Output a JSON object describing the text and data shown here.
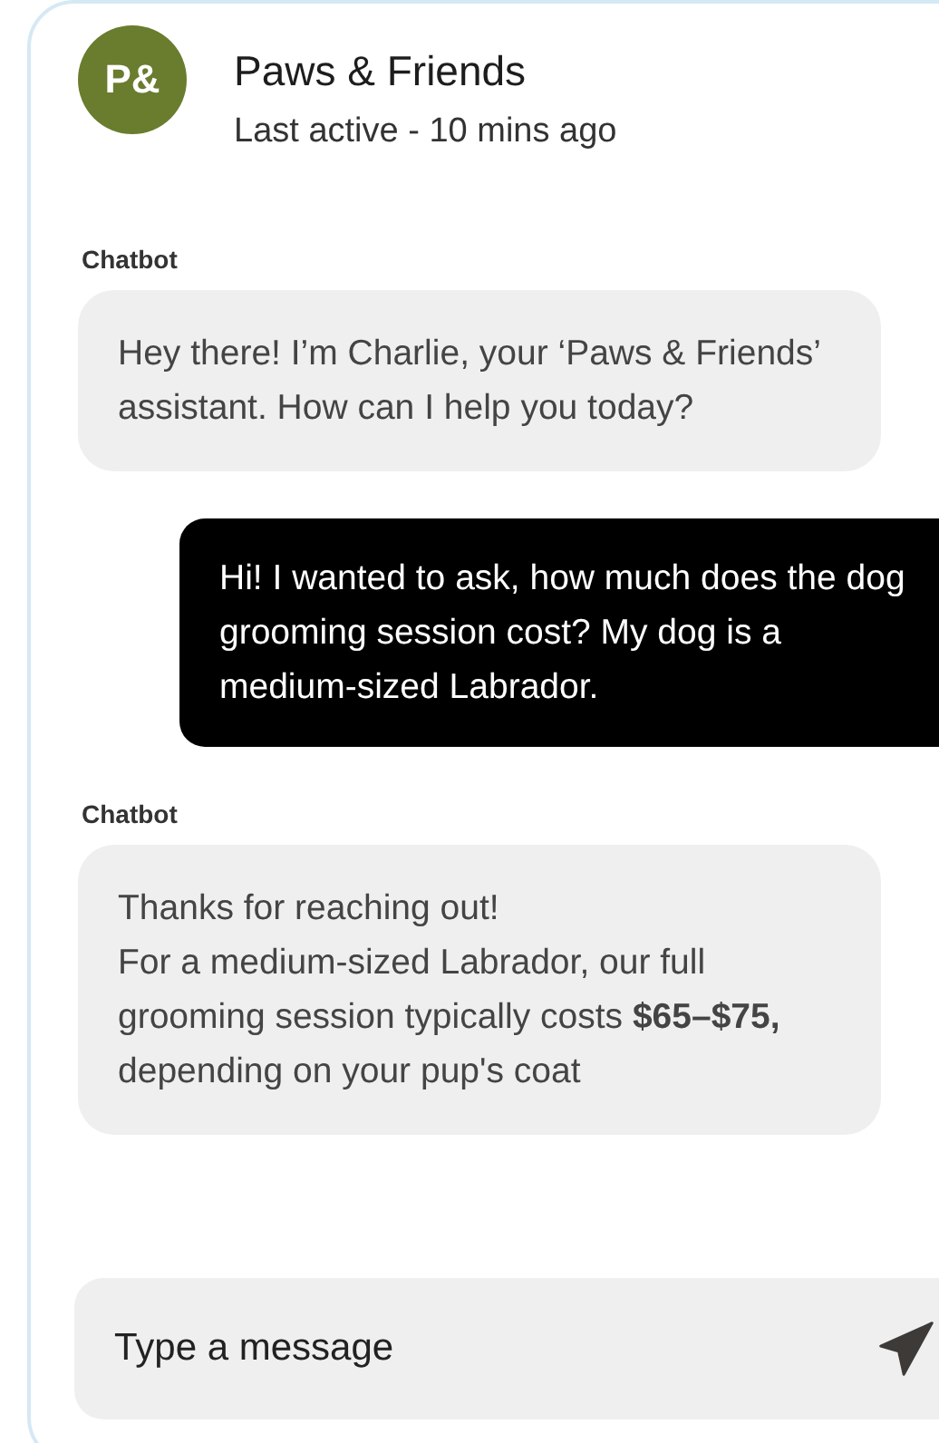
{
  "header": {
    "avatar": "P&",
    "title": "Paws & Friends",
    "status": "Last active - 10 mins ago"
  },
  "messages": [
    {
      "kind": "bot",
      "sender": "Chatbot",
      "text": "Hey there! I’m Charlie, your ‘Paws & Friends’ assistant. How can I help you today?"
    },
    {
      "kind": "user",
      "text": "Hi! I wanted to ask, how much does the dog grooming session cost? My dog is a medium-sized Labrador."
    },
    {
      "kind": "bot",
      "sender": "Chatbot",
      "text": "Thanks for reaching out!\nFor a medium-sized Labrador, our full grooming session typically costs **$65–$75,** depending on your pup's coat"
    }
  ],
  "composer": {
    "placeholder": "Type a message"
  }
}
